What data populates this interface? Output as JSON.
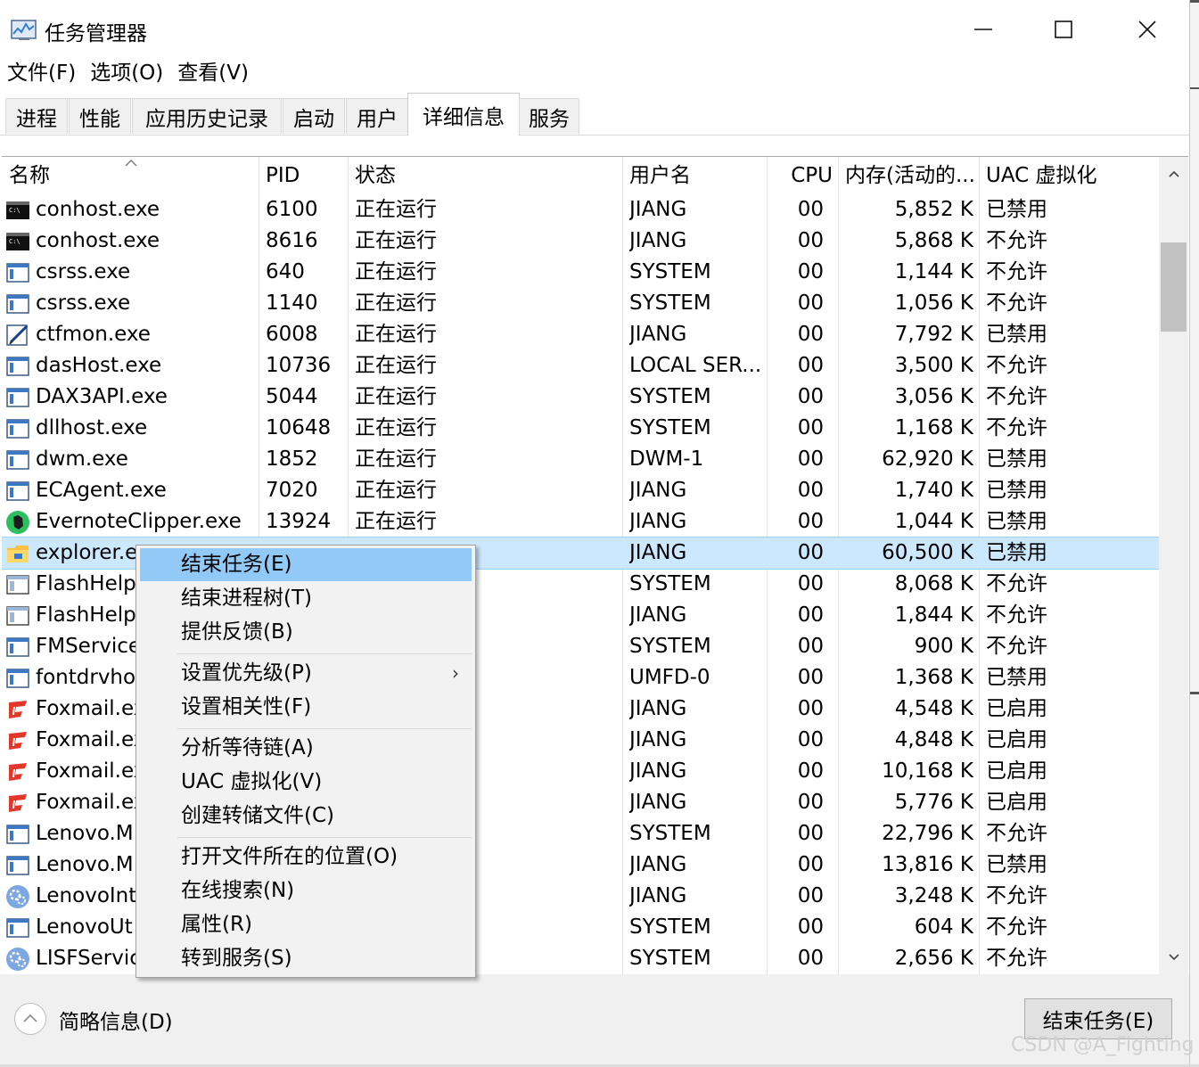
{
  "window": {
    "title": "任务管理器"
  },
  "menu": [
    "文件(F)",
    "选项(O)",
    "查看(V)"
  ],
  "tabs": [
    "进程",
    "性能",
    "应用历史记录",
    "启动",
    "用户",
    "详细信息",
    "服务"
  ],
  "active_tab": "详细信息",
  "columns": {
    "name": "名称",
    "pid": "PID",
    "status": "状态",
    "user": "用户名",
    "cpu": "CPU",
    "memory": "内存(活动的...",
    "uac": "UAC 虚拟化"
  },
  "rows": [
    {
      "name": "conhost.exe",
      "pid": "6100",
      "status": "正在运行",
      "user": "JIANG",
      "cpu": "00",
      "memory": "5,852 K",
      "uac": "已禁用",
      "icon": "console-icon"
    },
    {
      "name": "conhost.exe",
      "pid": "8616",
      "status": "正在运行",
      "user": "JIANG",
      "cpu": "00",
      "memory": "5,868 K",
      "uac": "不允许",
      "icon": "console-icon"
    },
    {
      "name": "csrss.exe",
      "pid": "640",
      "status": "正在运行",
      "user": "SYSTEM",
      "cpu": "00",
      "memory": "1,144 K",
      "uac": "不允许",
      "icon": "app-window-icon"
    },
    {
      "name": "csrss.exe",
      "pid": "1140",
      "status": "正在运行",
      "user": "SYSTEM",
      "cpu": "00",
      "memory": "1,056 K",
      "uac": "不允许",
      "icon": "app-window-icon"
    },
    {
      "name": "ctfmon.exe",
      "pid": "6008",
      "status": "正在运行",
      "user": "JIANG",
      "cpu": "00",
      "memory": "7,792 K",
      "uac": "已禁用",
      "icon": "pen-edit-icon"
    },
    {
      "name": "dasHost.exe",
      "pid": "10736",
      "status": "正在运行",
      "user": "LOCAL SER...",
      "cpu": "00",
      "memory": "3,500 K",
      "uac": "不允许",
      "icon": "app-window-icon"
    },
    {
      "name": "DAX3API.exe",
      "pid": "5044",
      "status": "正在运行",
      "user": "SYSTEM",
      "cpu": "00",
      "memory": "3,056 K",
      "uac": "不允许",
      "icon": "app-window-icon"
    },
    {
      "name": "dllhost.exe",
      "pid": "10648",
      "status": "正在运行",
      "user": "SYSTEM",
      "cpu": "00",
      "memory": "1,168 K",
      "uac": "不允许",
      "icon": "app-window-icon"
    },
    {
      "name": "dwm.exe",
      "pid": "1852",
      "status": "正在运行",
      "user": "DWM-1",
      "cpu": "00",
      "memory": "62,920 K",
      "uac": "已禁用",
      "icon": "app-window-icon"
    },
    {
      "name": "ECAgent.exe",
      "pid": "7020",
      "status": "正在运行",
      "user": "JIANG",
      "cpu": "00",
      "memory": "1,740 K",
      "uac": "已禁用",
      "icon": "app-window-icon"
    },
    {
      "name": "EvernoteClipper.exe",
      "pid": "13924",
      "status": "正在运行",
      "user": "JIANG",
      "cpu": "00",
      "memory": "1,044 K",
      "uac": "已禁用",
      "icon": "evernote-icon"
    },
    {
      "name": "explorer.e",
      "pid": "",
      "status": "",
      "user": "JIANG",
      "cpu": "00",
      "memory": "60,500 K",
      "uac": "已禁用",
      "icon": "folder-icon",
      "selected": true
    },
    {
      "name": "FlashHelp",
      "pid": "",
      "status": "",
      "user": "SYSTEM",
      "cpu": "00",
      "memory": "8,068 K",
      "uac": "不允许",
      "icon": "flash-window-icon"
    },
    {
      "name": "FlashHelp",
      "pid": "",
      "status": "",
      "user": "JIANG",
      "cpu": "00",
      "memory": "1,844 K",
      "uac": "不允许",
      "icon": "flash-window-icon"
    },
    {
      "name": "FMService",
      "pid": "",
      "status": "",
      "user": "SYSTEM",
      "cpu": "00",
      "memory": "900 K",
      "uac": "不允许",
      "icon": "app-window-icon"
    },
    {
      "name": "fontdrvho",
      "pid": "",
      "status": "",
      "user": "UMFD-0",
      "cpu": "00",
      "memory": "1,368 K",
      "uac": "已禁用",
      "icon": "app-window-icon"
    },
    {
      "name": "Foxmail.ex",
      "pid": "",
      "status": "",
      "user": "JIANG",
      "cpu": "00",
      "memory": "4,548 K",
      "uac": "已启用",
      "icon": "foxmail-icon"
    },
    {
      "name": "Foxmail.ex",
      "pid": "",
      "status": "",
      "user": "JIANG",
      "cpu": "00",
      "memory": "4,848 K",
      "uac": "已启用",
      "icon": "foxmail-icon"
    },
    {
      "name": "Foxmail.ex",
      "pid": "",
      "status": "",
      "user": "JIANG",
      "cpu": "00",
      "memory": "10,168 K",
      "uac": "已启用",
      "icon": "foxmail-icon"
    },
    {
      "name": "Foxmail.ex",
      "pid": "",
      "status": "",
      "user": "JIANG",
      "cpu": "00",
      "memory": "5,776 K",
      "uac": "已启用",
      "icon": "foxmail-icon"
    },
    {
      "name": "Lenovo.M",
      "pid": "",
      "status": "",
      "user": "SYSTEM",
      "cpu": "00",
      "memory": "22,796 K",
      "uac": "不允许",
      "icon": "app-window-icon"
    },
    {
      "name": "Lenovo.M",
      "pid": "",
      "status": "",
      "user": "JIANG",
      "cpu": "00",
      "memory": "13,816 K",
      "uac": "已禁用",
      "icon": "app-window-icon"
    },
    {
      "name": "LenovoInt",
      "pid": "",
      "status": "",
      "user": "JIANG",
      "cpu": "00",
      "memory": "3,248 K",
      "uac": "不允许",
      "icon": "service-gear-icon"
    },
    {
      "name": "LenovoUt",
      "pid": "",
      "status": "",
      "user": "SYSTEM",
      "cpu": "00",
      "memory": "604 K",
      "uac": "不允许",
      "icon": "app-window-icon"
    },
    {
      "name": "LISFServic",
      "pid": "",
      "status": "",
      "user": "SYSTEM",
      "cpu": "00",
      "memory": "2,656 K",
      "uac": "不允许",
      "icon": "service-gear-icon"
    }
  ],
  "context_menu": {
    "items": [
      {
        "label": "结束任务(E)",
        "group": 0
      },
      {
        "label": "结束进程树(T)",
        "group": 0
      },
      {
        "label": "提供反馈(B)",
        "group": 0
      },
      {
        "label": "设置优先级(P)",
        "group": 1,
        "submenu": true
      },
      {
        "label": "设置相关性(F)",
        "group": 1
      },
      {
        "label": "分析等待链(A)",
        "group": 2
      },
      {
        "label": "UAC 虚拟化(V)",
        "group": 2
      },
      {
        "label": "创建转储文件(C)",
        "group": 2
      },
      {
        "label": "打开文件所在的位置(O)",
        "group": 3
      },
      {
        "label": "在线搜索(N)",
        "group": 3
      },
      {
        "label": "属性(R)",
        "group": 3
      },
      {
        "label": "转到服务(S)",
        "group": 3
      }
    ],
    "highlighted": "结束任务(E)",
    "submenu_arrow": "›"
  },
  "footer": {
    "brief_label": "简略信息(D)",
    "end_task_label": "结束任务(E)"
  },
  "watermark": "CSDN @A_Fighting",
  "colors": {
    "selection_bg": "#cce8ff",
    "menu_highlight": "#91c9f7",
    "foxmail_red": "#e2382b",
    "evernote_green": "#2dbe60"
  }
}
